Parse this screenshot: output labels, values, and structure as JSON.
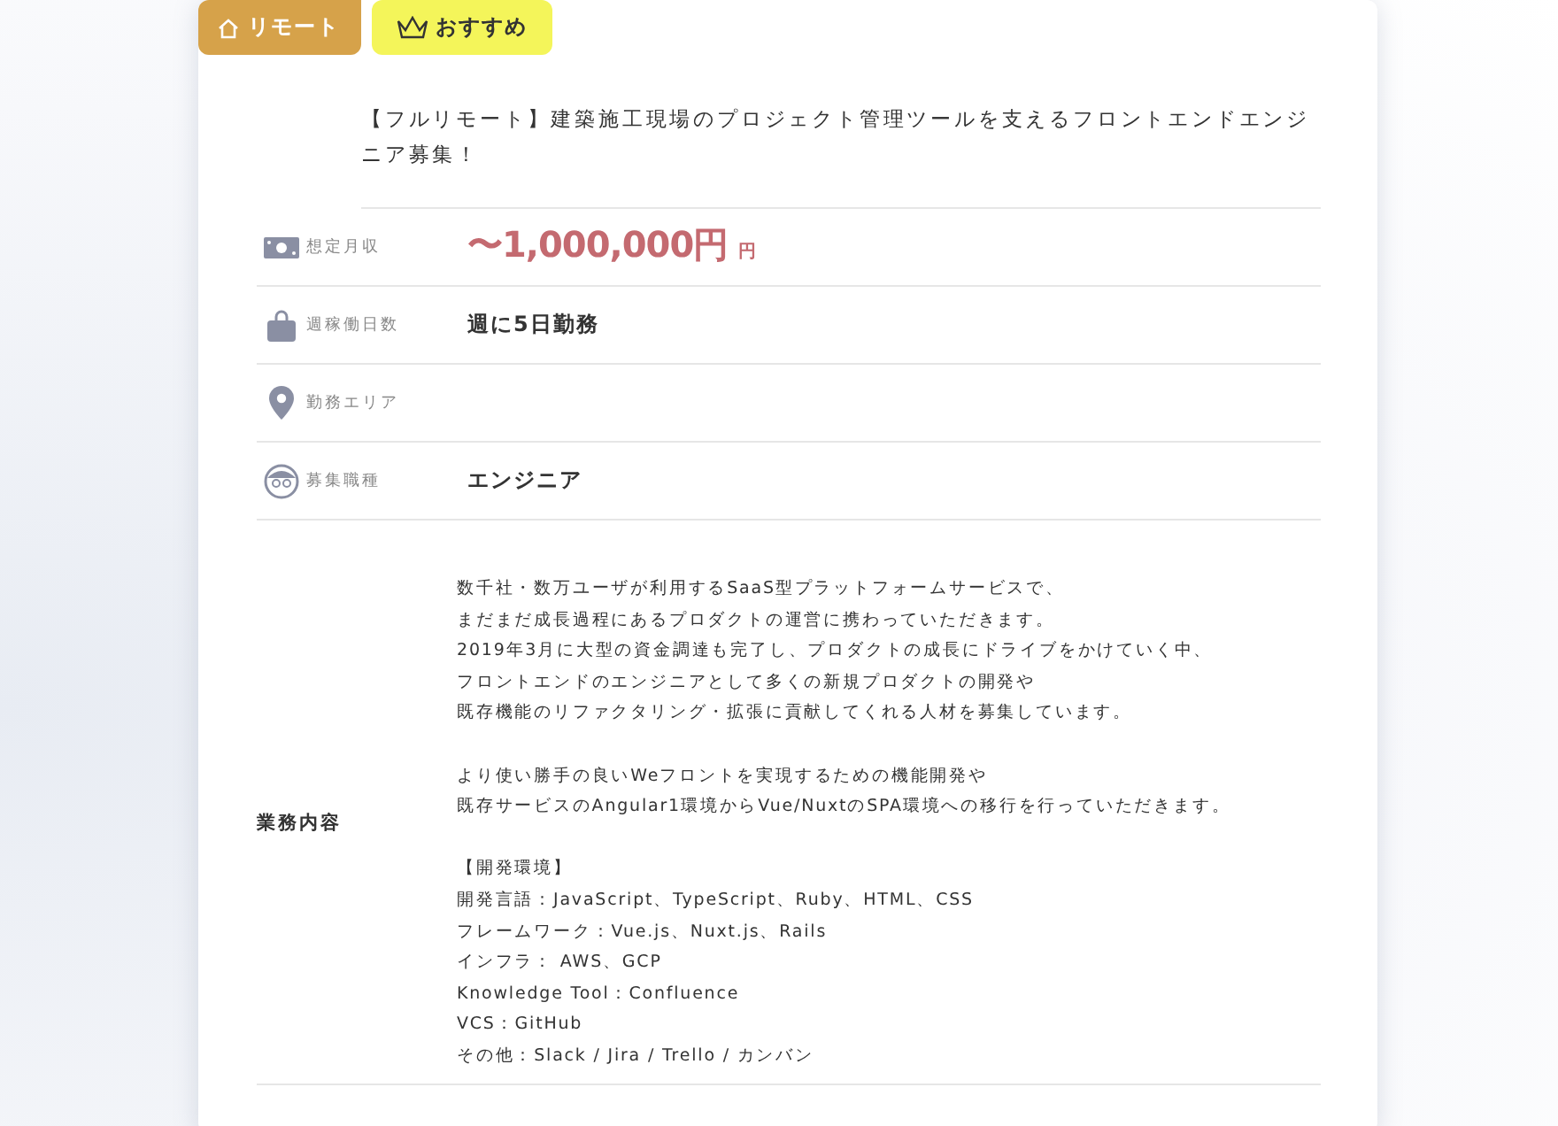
{
  "tags": [
    {
      "kind": "remote",
      "label": "リモート"
    },
    {
      "kind": "recommended",
      "label": "おすすめ"
    }
  ],
  "title": "【フルリモート】建築施工現場のプロジェクト管理ツールを支えるフロントエンドエンジニア募集！",
  "info_rows": [
    {
      "kind": "salary",
      "label": "想定月収",
      "value": "〜1,000,000円",
      "unit": "円"
    },
    {
      "kind": "days",
      "label": "週稼働日数",
      "value": "週に5日勤務"
    },
    {
      "kind": "area",
      "label": "勤務エリア"
    },
    {
      "kind": "role",
      "label": "募集職種",
      "value": "エンジニア"
    }
  ],
  "job_description": {
    "label": "業務内容",
    "paragraphs": [
      [
        "数千社・数万ユーザが利用するSaaS型プラットフォームサービスで、",
        "まだまだ成長過程にあるプロダクトの運営に携わっていただきます。",
        "2019年3月に大型の資金調達も完了し、プロダクトの成長にドライブをかけていく中、",
        "フロントエンドのエンジニアとして多くの新規プロダクトの開発や",
        "既存機能のリファクタリング・拡張に貢献してくれる人材を募集しています。"
      ],
      [
        "より使い勝手の良いWeフロントを実現するための機能開発や",
        "既存サービスのAngular1環境からVue/NuxtのSPA環境への移行を行っていただきます。"
      ],
      [
        "【開発環境】",
        "開発言語：JavaScript、TypeScript、Ruby、HTML、CSS",
        "フレームワーク：Vue.js、Nuxt.js、Rails",
        "インフラ： AWS、GCP",
        "Knowledge Tool：Confluence",
        "VCS：GitHub",
        "その他：Slack / Jira / Trello / カンバン"
      ]
    ]
  }
}
